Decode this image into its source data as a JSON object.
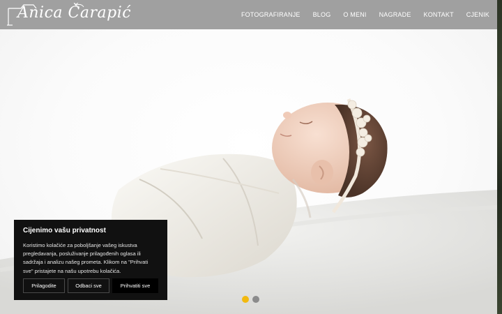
{
  "header": {
    "logo_text": "Anica Čarapić",
    "nav": [
      {
        "label": "FOTOGRAFIRANJE"
      },
      {
        "label": "BLOG"
      },
      {
        "label": "O MENI"
      },
      {
        "label": "NAGRADE"
      },
      {
        "label": "KONTAKT"
      },
      {
        "label": "CJENIK"
      }
    ]
  },
  "slider": {
    "dots": 2,
    "active_index": 0,
    "active_color": "#f2b90f",
    "inactive_color": "#8b8b8b"
  },
  "cookie": {
    "title": "Cijenimo vašu privatnost",
    "lines": [
      "Koristimo kolačiće za poboljšanje vašeg iskustva",
      "pregledavanja, posluživanje prilagođenih oglasa ili",
      "sadržaja i analizu našeg prometa. Klikom na \"Prihvati",
      "sve\" pristajete na našu upotrebu kolačića."
    ],
    "buttons": {
      "customize": "Prilagodite",
      "reject": "Odbaci sve",
      "accept": "Prihvatiti sve"
    }
  },
  "colors": {
    "header_bg": "#a0a0a0",
    "cookie_bg": "#111111"
  }
}
